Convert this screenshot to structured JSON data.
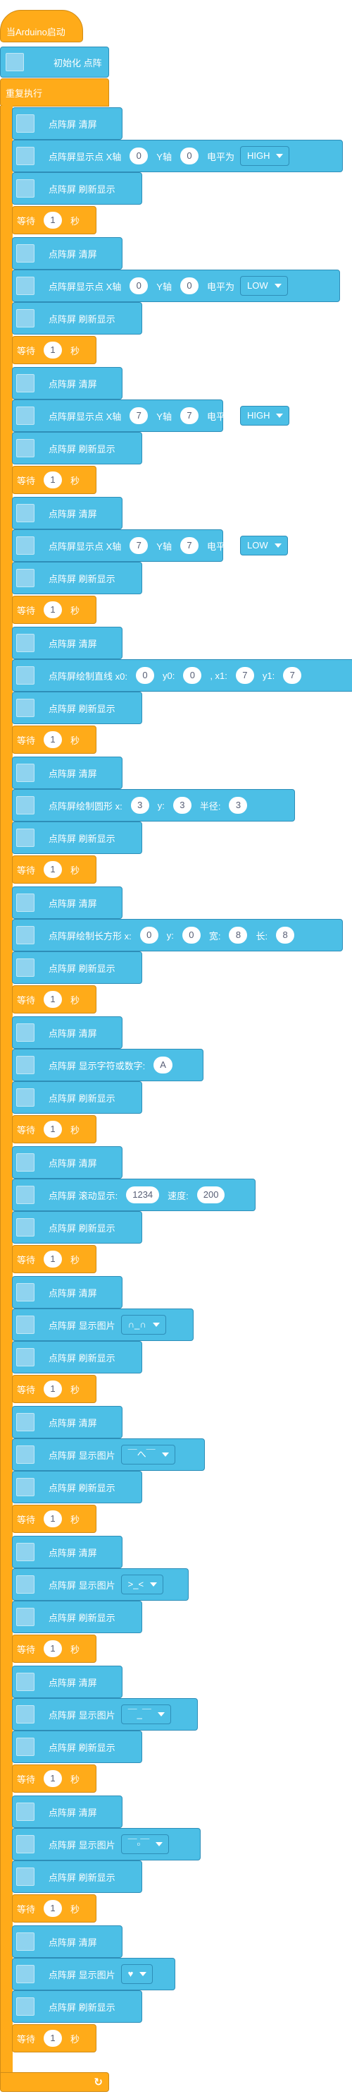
{
  "hat_label": "当Arduino启动",
  "init_label": "初始化 点阵",
  "repeat_label": "重复执行",
  "loop_icon": "↻",
  "common": {
    "clear": "点阵屏 清屏",
    "refresh": "点阵屏 刷新显示",
    "wait_label": "等待",
    "wait_unit": "秒",
    "wait_value": "1"
  },
  "steps": [
    {
      "type": "point",
      "prefix": "点阵屏显示点 X轴",
      "x": "0",
      "y_label": "Y轴",
      "y": "0",
      "level_label": "电平为",
      "level": "HIGH"
    },
    {
      "type": "point",
      "prefix": "点阵屏显示点 X轴",
      "x": "0",
      "y_label": "Y轴",
      "y": "0",
      "level_label": "电平为",
      "level": "LOW"
    },
    {
      "type": "point",
      "prefix": "点阵屏显示点 X轴",
      "x": "7",
      "y_label": "Y轴",
      "y": "7",
      "level_label": "电平为",
      "level": "HIGH"
    },
    {
      "type": "point",
      "prefix": "点阵屏显示点 X轴",
      "x": "7",
      "y_label": "Y轴",
      "y": "7",
      "level_label": "电平为",
      "level": "LOW"
    },
    {
      "type": "line",
      "prefix": "点阵屏绘制直线 x0:",
      "x0": "0",
      "y0_label": "y0:",
      "y0": "0",
      "x1_label": ", x1:",
      "x1": "7",
      "y1_label": "y1:",
      "y1": "7"
    },
    {
      "type": "circle",
      "prefix": "点阵屏绘制圆形 x:",
      "x": "3",
      "y_label": "y:",
      "y": "3",
      "r_label": "半径:",
      "r": "3"
    },
    {
      "type": "rect",
      "prefix": "点阵屏绘制长方形 x:",
      "x": "0",
      "y_label": "y:",
      "y": "0",
      "w_label": "宽:",
      "w": "8",
      "h_label": "长:",
      "h": "8"
    },
    {
      "type": "char",
      "prefix": "点阵屏 显示字符或数字:",
      "value": "A"
    },
    {
      "type": "scroll",
      "prefix": "点阵屏 滚动显示:",
      "value": "1234",
      "speed_label": "速度:",
      "speed": "200"
    },
    {
      "type": "image",
      "prefix": "点阵屏 显示图片",
      "value": "∩_∩"
    },
    {
      "type": "image",
      "prefix": "点阵屏 显示图片",
      "value": "￣へ￣"
    },
    {
      "type": "image",
      "prefix": "点阵屏 显示图片",
      "value": ">_<"
    },
    {
      "type": "image",
      "prefix": "点阵屏 显示图片",
      "value": "￣_￣"
    },
    {
      "type": "image",
      "prefix": "点阵屏 显示图片",
      "value": "￣▫￣"
    },
    {
      "type": "image",
      "prefix": "点阵屏 显示图片",
      "value": "♥"
    }
  ]
}
